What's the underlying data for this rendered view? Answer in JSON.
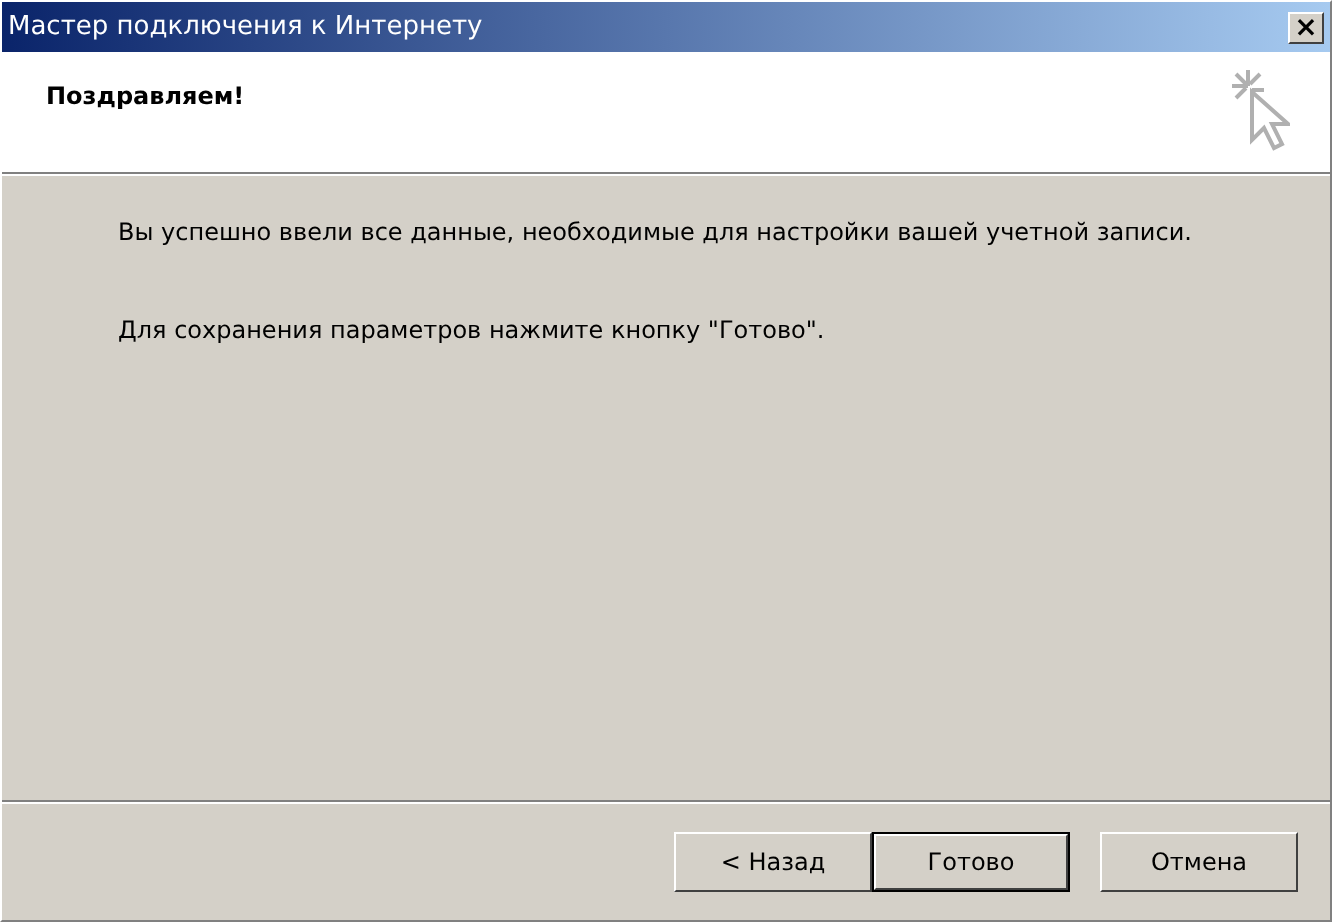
{
  "window": {
    "title": "Мастер подключения к Интернету",
    "close": "×"
  },
  "header": {
    "title": "Поздравляем!"
  },
  "paragraphs": [
    "Вы успешно ввели все данные, необходимые для настройки вашей учетной записи.",
    "Для сохранения параметров нажмите кнопку \"Готово\"."
  ],
  "buttons": [
    {
      "label": "< Назад",
      "default": false,
      "kind": "back"
    },
    {
      "label": "Готово",
      "default": true,
      "kind": "finish"
    },
    {
      "label": "Отмена",
      "default": false,
      "kind": "cancel"
    }
  ]
}
